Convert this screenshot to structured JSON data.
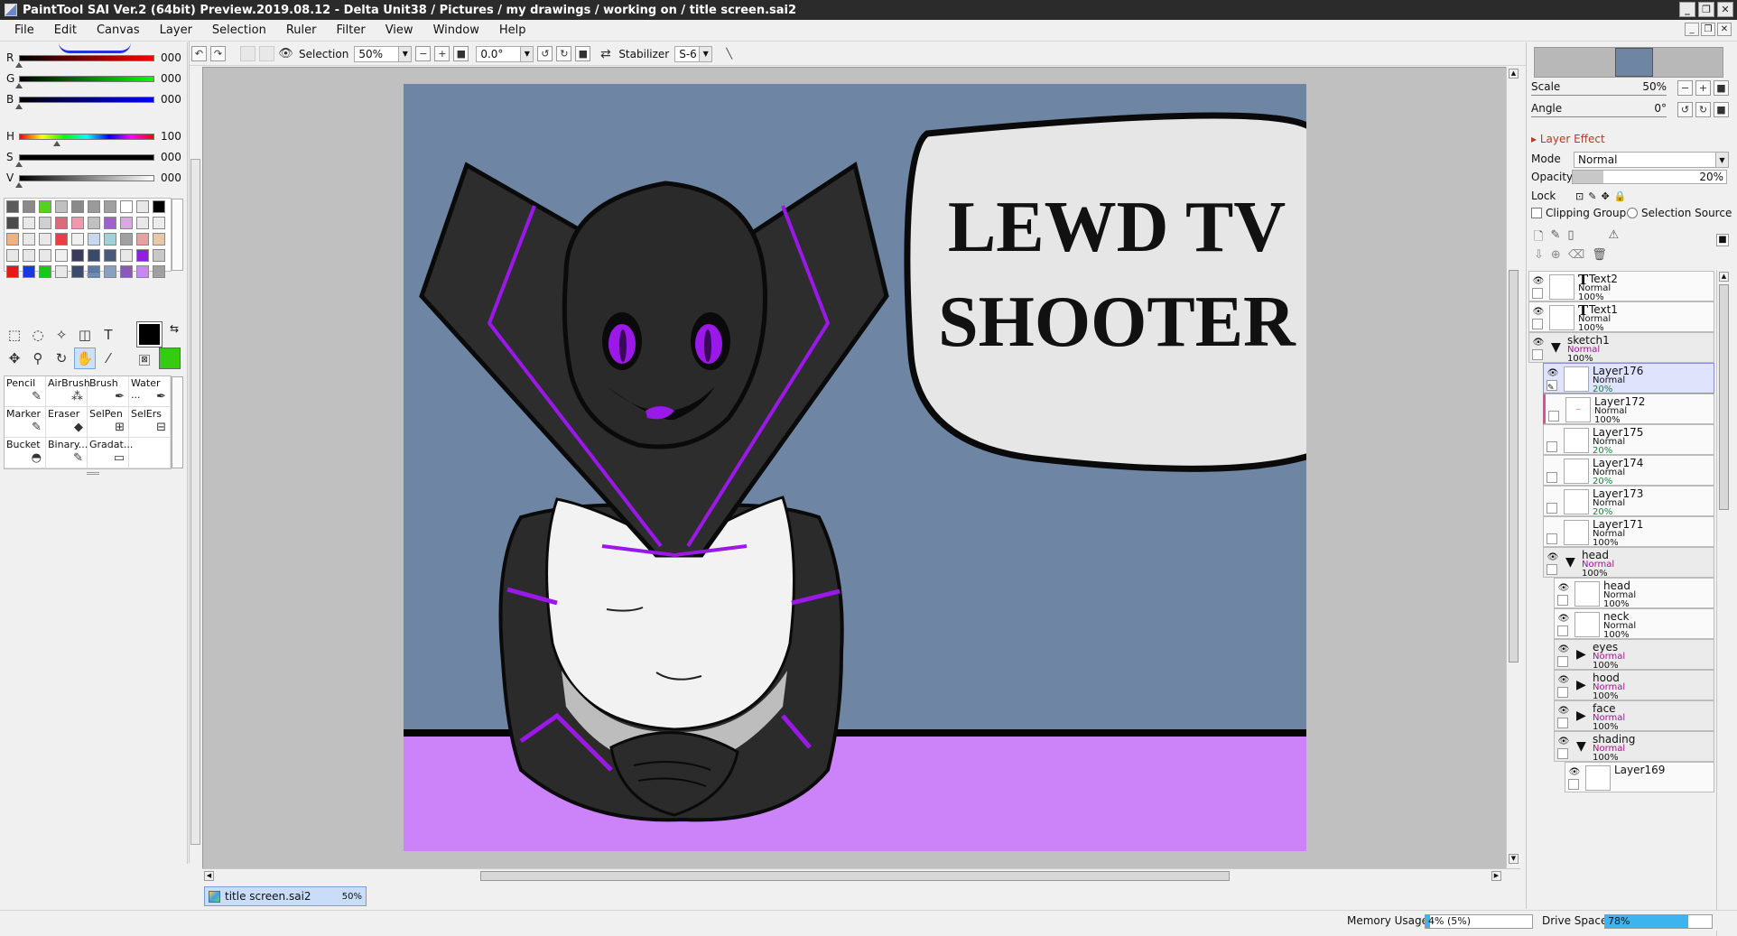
{
  "window": {
    "title": "PaintTool SAI Ver.2 (64bit) Preview.2019.08.12 - Delta Unit38 / Pictures / my drawings / working on / title screen.sai2",
    "controls": [
      "_",
      "❐",
      "✕"
    ]
  },
  "menu": [
    "File",
    "Edit",
    "Canvas",
    "Layer",
    "Selection",
    "Ruler",
    "Filter",
    "View",
    "Window",
    "Help"
  ],
  "color_sliders": [
    {
      "label": "R",
      "value": "000"
    },
    {
      "label": "G",
      "value": "000"
    },
    {
      "label": "B",
      "value": "000"
    },
    {
      "label": "H",
      "value": "100"
    },
    {
      "label": "S",
      "value": "000"
    },
    {
      "label": "V",
      "value": "000"
    }
  ],
  "swatches": [
    "#5a5a5a",
    "#8a8a8a",
    "#55d11e",
    "#c0c0c0",
    "#8a8a8a",
    "#9a9a9a",
    "#a0a0a0",
    "#ffffff",
    "#e8e8e8",
    "#000000",
    "#4a4a4a",
    "#e8e8e8",
    "#d0d0d0",
    "#d86a7a",
    "#f098b0",
    "#c0c0c0",
    "#9e62c8",
    "#d8a8e0",
    "#e8e8e8",
    "#ececec",
    "#f0b080",
    "#e8e8e8",
    "#e8e8e8",
    "#e84040",
    "#f0f0f0",
    "#c8d8f0",
    "#a0d0d8",
    "#a0a0a0",
    "#e8a0a0",
    "#e8c8a8",
    "#e8e8e8",
    "#e8e8e8",
    "#e8e8e8",
    "#f0f0f0",
    "#3a3a5a",
    "#3a4a6a",
    "#4a5a7a",
    "#e8e8e8",
    "#9020e0",
    "#c8c8c8",
    "#e81818",
    "#1838e0",
    "#18c818",
    "#e8e8e8",
    "#3a4a6a",
    "#5a7aa8",
    "#8aa0c0",
    "#8a5ab8",
    "#c888f0",
    "#a0a0a0"
  ],
  "tools": [
    {
      "name": "rect-select-icon",
      "glyph": "⬚"
    },
    {
      "name": "lasso-icon",
      "glyph": "◌"
    },
    {
      "name": "magic-wand-icon",
      "glyph": "✧"
    },
    {
      "name": "shapes-icon",
      "glyph": "◫"
    },
    {
      "name": "text-tool-icon",
      "glyph": "T"
    },
    {
      "name": "move-icon",
      "glyph": "✥"
    },
    {
      "name": "zoom-icon",
      "glyph": "⚲"
    },
    {
      "name": "rotate-icon",
      "glyph": "↻"
    },
    {
      "name": "hand-icon",
      "glyph": "✋"
    },
    {
      "name": "eyedropper-icon",
      "glyph": "⁄"
    }
  ],
  "colors": {
    "primary": "#000000",
    "secondary": "#33cc11"
  },
  "brushes": [
    {
      "label": "Pencil",
      "icon": "✎"
    },
    {
      "label": "AirBrush",
      "icon": "⁂"
    },
    {
      "label": "Brush",
      "icon": "✒"
    },
    {
      "label": "Water ...",
      "icon": "✒"
    },
    {
      "label": "Marker",
      "icon": "✎"
    },
    {
      "label": "Eraser",
      "icon": "◆"
    },
    {
      "label": "SelPen",
      "icon": "⊞"
    },
    {
      "label": "SelErs",
      "icon": "⊟"
    },
    {
      "label": "Bucket",
      "icon": "◓"
    },
    {
      "label": "Binary...",
      "icon": "✎"
    },
    {
      "label": "Gradat...",
      "icon": "▭"
    },
    {
      "label": "",
      "icon": ""
    }
  ],
  "toolbar": {
    "selection_label": "Selection",
    "zoom": "50%",
    "angle": "0.0°",
    "stabilizer_label": "Stabilizer",
    "stabilizer_value": "S-6"
  },
  "artwork": {
    "title_line1": "LEWD TV",
    "title_line2": "SHOOTER",
    "bg_color": "#6e85a4",
    "desk_color": "#cc82f9",
    "accent_purple": "#9a18e8"
  },
  "doc_tab": {
    "name": "title screen.sai2",
    "zoom": "50%"
  },
  "status": {
    "memory_label": "Memory Usage",
    "memory_value": "4% (5%)",
    "memory_fraction": 0.04,
    "drive_label": "Drive Space",
    "drive_value": "78%",
    "drive_fraction": 0.78
  },
  "navigator": {
    "scale_label": "Scale",
    "scale_value": "50%",
    "angle_label": "Angle",
    "angle_value": "0°"
  },
  "layer_props": {
    "section": "Layer Effect",
    "mode_label": "Mode",
    "mode_value": "Normal",
    "opacity_label": "Opacity",
    "opacity_value": "20%",
    "opacity_fraction": 0.2,
    "lock_label": "Lock",
    "clipping_label": "Clipping Group",
    "selection_source_label": "Selection Source"
  },
  "layers": [
    {
      "name": "Text2",
      "mode": "Normal",
      "opacity": "100%",
      "type": "text",
      "visible": true,
      "indent": 0
    },
    {
      "name": "Text1",
      "mode": "Normal",
      "opacity": "100%",
      "type": "text",
      "visible": true,
      "indent": 0
    },
    {
      "name": "sketch1",
      "mode": "Normal",
      "opacity": "100%",
      "type": "folder",
      "visible": true,
      "indent": 0,
      "open": true
    },
    {
      "name": "Layer176",
      "mode": "Normal",
      "opacity": "20%",
      "type": "layer",
      "visible": true,
      "indent": 1,
      "selected": true
    },
    {
      "name": "Layer172",
      "mode": "Normal",
      "opacity": "100%",
      "type": "layer",
      "visible": false,
      "indent": 1,
      "clip": true
    },
    {
      "name": "Layer175",
      "mode": "Normal",
      "opacity": "20%",
      "type": "layer",
      "visible": false,
      "indent": 1
    },
    {
      "name": "Layer174",
      "mode": "Normal",
      "opacity": "20%",
      "type": "layer",
      "visible": false,
      "indent": 1
    },
    {
      "name": "Layer173",
      "mode": "Normal",
      "opacity": "20%",
      "type": "layer",
      "visible": false,
      "indent": 1
    },
    {
      "name": "Layer171",
      "mode": "Normal",
      "opacity": "100%",
      "type": "layer",
      "visible": false,
      "indent": 1
    },
    {
      "name": "head",
      "mode": "Normal",
      "opacity": "100%",
      "type": "folder",
      "visible": true,
      "indent": 1,
      "open": true
    },
    {
      "name": "head",
      "mode": "Normal",
      "opacity": "100%",
      "type": "layer",
      "visible": true,
      "indent": 2
    },
    {
      "name": "neck",
      "mode": "Normal",
      "opacity": "100%",
      "type": "layer",
      "visible": true,
      "indent": 2
    },
    {
      "name": "eyes",
      "mode": "Normal",
      "opacity": "100%",
      "type": "folder",
      "visible": true,
      "indent": 2,
      "open": false
    },
    {
      "name": "hood",
      "mode": "Normal",
      "opacity": "100%",
      "type": "folder",
      "visible": true,
      "indent": 2,
      "open": false
    },
    {
      "name": "face",
      "mode": "Normal",
      "opacity": "100%",
      "type": "folder",
      "visible": true,
      "indent": 2,
      "open": false
    },
    {
      "name": "shading",
      "mode": "Normal",
      "opacity": "100%",
      "type": "folder",
      "visible": true,
      "indent": 2,
      "open": true
    },
    {
      "name": "Layer169",
      "mode": "",
      "opacity": "",
      "type": "layer",
      "visible": true,
      "indent": 3
    }
  ]
}
